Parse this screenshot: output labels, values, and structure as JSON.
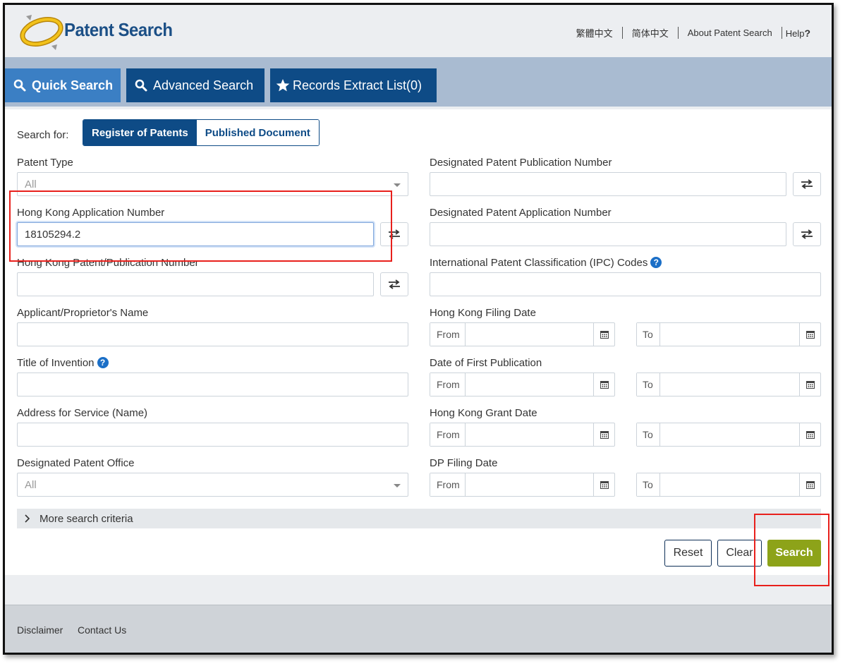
{
  "header": {
    "brand": "Patent Search",
    "links": [
      "繁體中文",
      "简体中文",
      "About Patent Search",
      "Help"
    ],
    "help_mark": "?"
  },
  "tabs": [
    {
      "label": "Quick Search",
      "icon": "search-icon",
      "active": true
    },
    {
      "label": "Advanced Search",
      "icon": "search-icon",
      "active": false
    },
    {
      "label": "Records Extract List(0)",
      "icon": "star-icon",
      "active": false
    }
  ],
  "search_for": {
    "label": "Search for:",
    "options": [
      "Register of Patents",
      "Published Document"
    ],
    "selected": "Register of Patents"
  },
  "left_fields": {
    "patent_type": {
      "label": "Patent Type",
      "value": "All"
    },
    "hk_app_number": {
      "label": "Hong Kong Application Number",
      "value": "18105294.2"
    },
    "hk_patent_number": {
      "label": "Hong Kong Patent/Publication Number",
      "value": ""
    },
    "applicant": {
      "label": "Applicant/Proprietor's Name",
      "value": ""
    },
    "title": {
      "label": "Title of Invention",
      "value": ""
    },
    "address": {
      "label": "Address for Service (Name)",
      "value": ""
    },
    "designated_office": {
      "label": "Designated Patent Office",
      "value": "All"
    }
  },
  "right_fields": {
    "dp_pub_number": {
      "label": "Designated Patent Publication Number",
      "value": ""
    },
    "dp_app_number": {
      "label": "Designated Patent Application Number",
      "value": ""
    },
    "ipc": {
      "label": "International Patent Classification (IPC) Codes",
      "value": ""
    }
  },
  "date_fields": [
    {
      "label": "Hong Kong Filing Date",
      "from": "From",
      "to": "To"
    },
    {
      "label": "Date of First Publication",
      "from": "From",
      "to": "To"
    },
    {
      "label": "Hong Kong Grant Date",
      "from": "From",
      "to": "To"
    },
    {
      "label": "DP Filing Date",
      "from": "From",
      "to": "To"
    }
  ],
  "more_criteria": "More search criteria",
  "buttons": {
    "reset": "Reset",
    "clear": "Clear",
    "search": "Search"
  },
  "footer": {
    "disclaimer": "Disclaimer",
    "contact": "Contact Us"
  },
  "colors": {
    "navy": "#0e4b86",
    "active_tab": "#3b7fc4",
    "search_button": "#8da319",
    "annotation": "#e8201c"
  }
}
